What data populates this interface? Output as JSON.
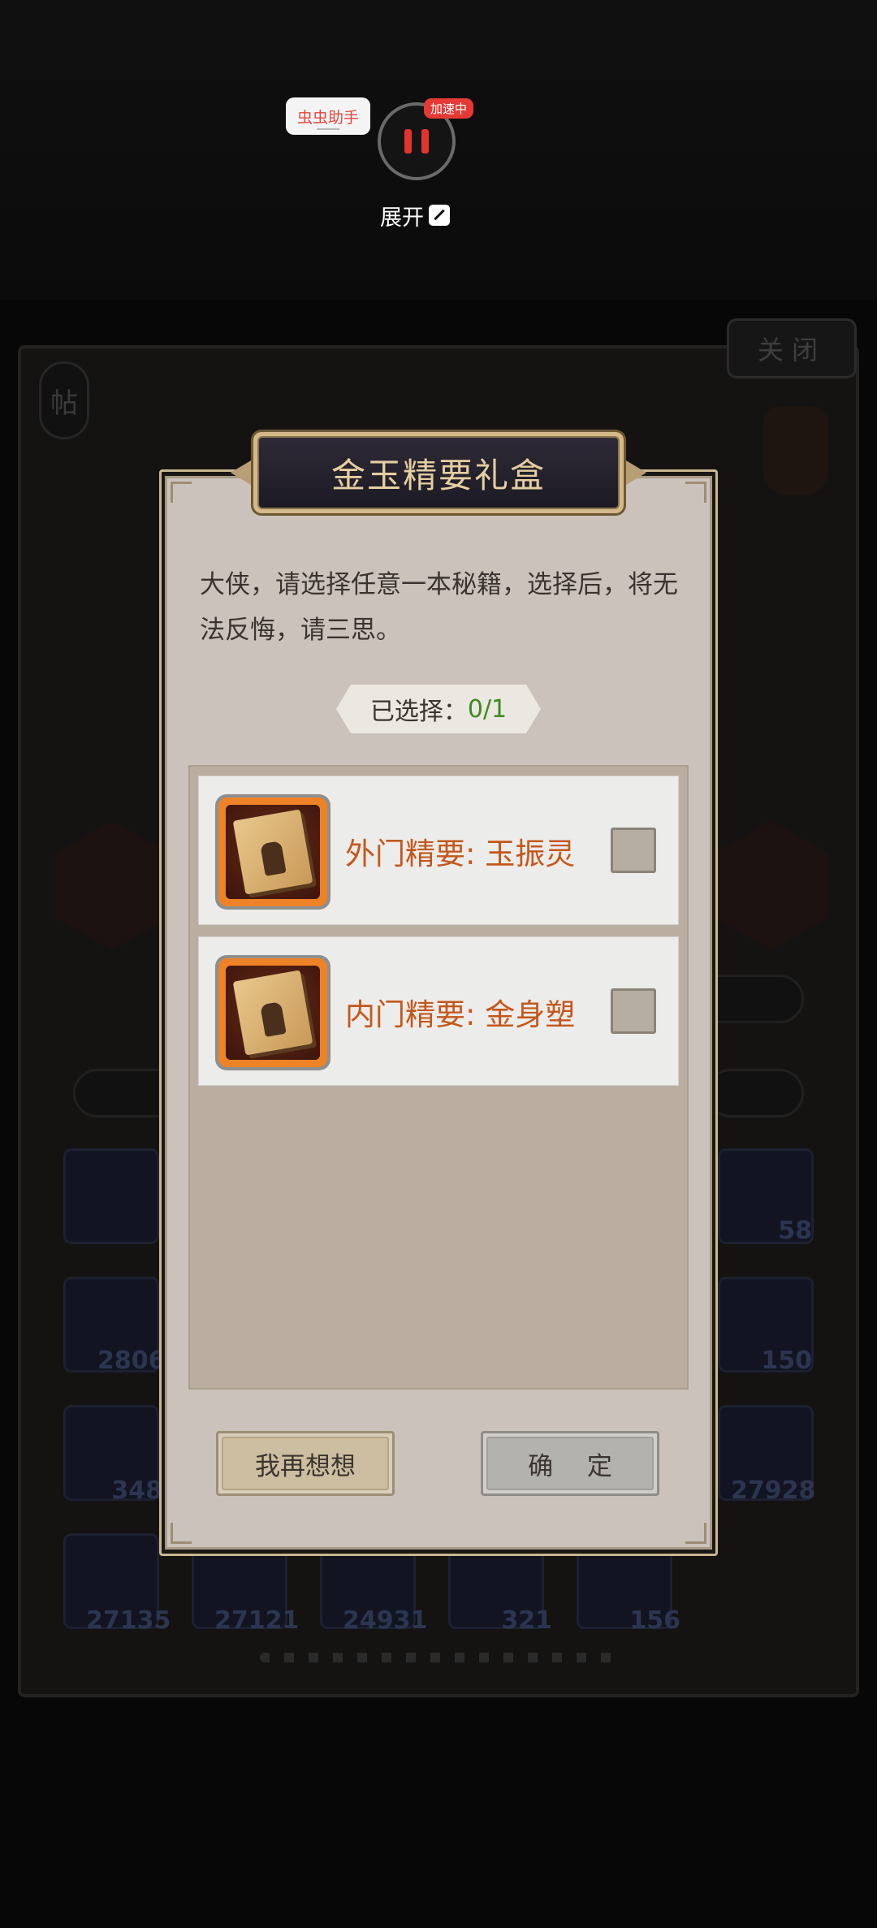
{
  "overlay": {
    "helper_label": "虫虫助手",
    "speed_tag": "加速中",
    "expand_label": "展开"
  },
  "background": {
    "close_label": "关闭",
    "tie_label": "帖",
    "counts": [
      "58",
      "2806",
      "150",
      "348",
      "27928",
      "27135",
      "27121",
      "24931",
      "321",
      "156"
    ]
  },
  "dialog": {
    "title": "金玉精要礼盒",
    "description": "大侠，请选择任意一本秘籍，选择后，将无法反悔，请三思。",
    "selected_label": "已选择：",
    "selected_count": "0/1",
    "items": [
      {
        "name": "外门精要: 玉振灵",
        "checked": false
      },
      {
        "name": "内门精要: 金身塑",
        "checked": false
      }
    ],
    "buttons": {
      "think_label": "我再想想",
      "confirm_label": "确 定"
    }
  },
  "colors": {
    "title_text": "#e6cea0",
    "item_name": "#c4571c",
    "selected_count": "#3f8a1f",
    "panel": "#cbc2bb"
  },
  "icons": [
    "pause-icon",
    "expand-icon",
    "book-icon"
  ]
}
